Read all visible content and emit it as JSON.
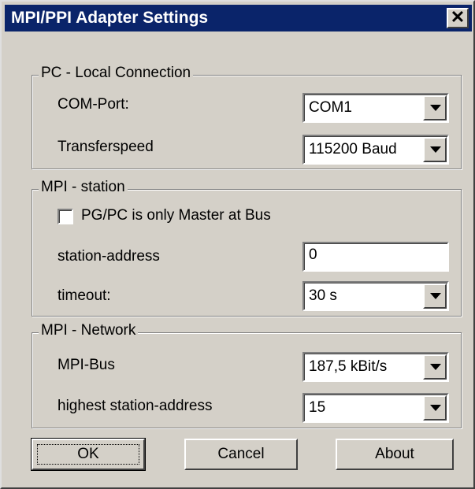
{
  "window": {
    "title": "MPI/PPI Adapter Settings",
    "close_label": "✕"
  },
  "pc_local": {
    "legend": "PC - Local Connection",
    "com_port_label": "COM-Port:",
    "com_port_value": "COM1",
    "speed_label": "Transferspeed",
    "speed_value": "115200 Baud"
  },
  "mpi_station": {
    "legend": "MPI - station",
    "master_checkbox_label": "PG/PC is only Master at Bus",
    "master_checked": false,
    "address_label": "station-address",
    "address_value": "0",
    "timeout_label": "timeout:",
    "timeout_value": "30 s"
  },
  "mpi_network": {
    "legend": "MPI - Network",
    "bus_label": "MPI-Bus",
    "bus_value": "187,5 kBit/s",
    "highest_label": "highest station-address",
    "highest_value": "15"
  },
  "buttons": {
    "ok": "OK",
    "cancel": "Cancel",
    "about": "About"
  },
  "colors": {
    "titlebar": "#0a246a",
    "face": "#d4d0c8"
  }
}
